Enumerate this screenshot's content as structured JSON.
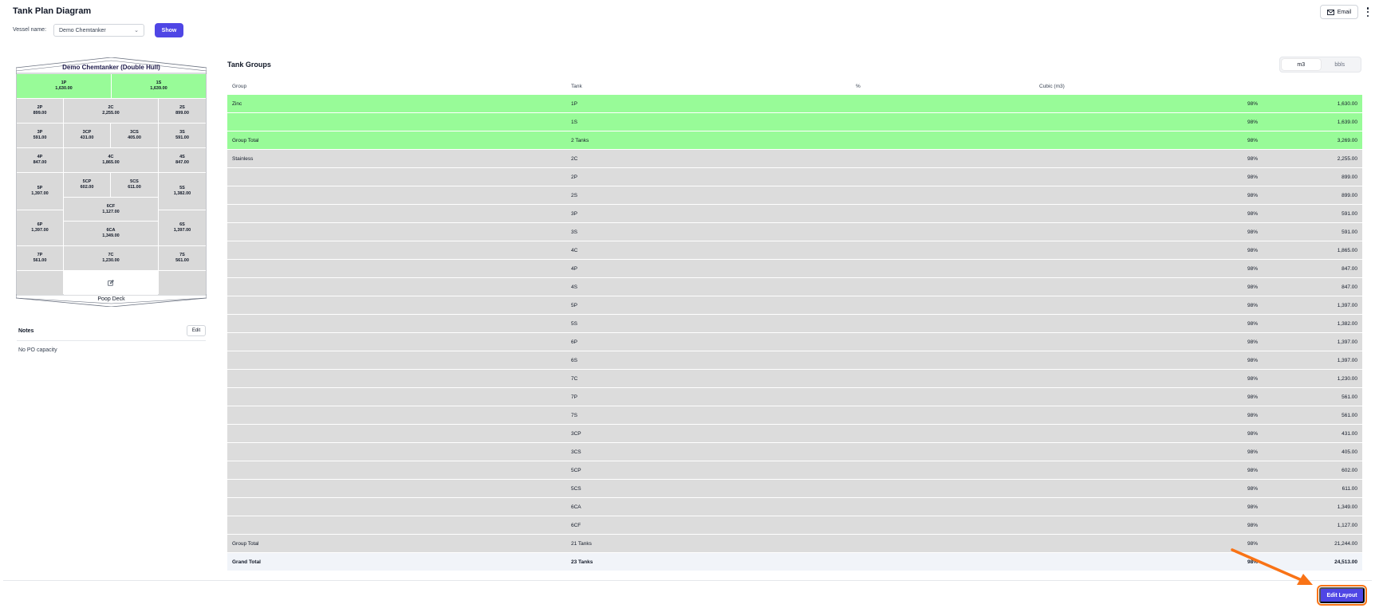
{
  "header": {
    "title": "Tank Plan Diagram",
    "email_label": "Email"
  },
  "vessel": {
    "label": "Vessel name:",
    "selected": "Demo Chemtanker",
    "show_label": "Show"
  },
  "diagram": {
    "ship_name": "Demo Chemtanker (Double Hull)",
    "poop_deck": "Poop Deck",
    "tanks": {
      "t1p": {
        "name": "1P",
        "value": "1,630.00"
      },
      "t1s": {
        "name": "1S",
        "value": "1,639.00"
      },
      "t2p": {
        "name": "2P",
        "value": "899.00"
      },
      "t2c": {
        "name": "2C",
        "value": "2,255.00"
      },
      "t2s": {
        "name": "2S",
        "value": "899.00"
      },
      "t3p": {
        "name": "3P",
        "value": "591.00"
      },
      "t3cp": {
        "name": "3CP",
        "value": "431.00"
      },
      "t3cs": {
        "name": "3CS",
        "value": "405.00"
      },
      "t3s": {
        "name": "3S",
        "value": "591.00"
      },
      "t4p": {
        "name": "4P",
        "value": "847.00"
      },
      "t4c": {
        "name": "4C",
        "value": "1,865.00"
      },
      "t4s": {
        "name": "4S",
        "value": "847.00"
      },
      "t5p": {
        "name": "5P",
        "value": "1,397.00"
      },
      "t5cp": {
        "name": "5CP",
        "value": "602.00"
      },
      "t5cs": {
        "name": "5CS",
        "value": "611.00"
      },
      "t5s": {
        "name": "5S",
        "value": "1,382.00"
      },
      "t6cf": {
        "name": "6CF",
        "value": "1,127.00"
      },
      "t6p": {
        "name": "6P",
        "value": "1,397.00"
      },
      "t6ca": {
        "name": "6CA",
        "value": "1,349.00"
      },
      "t6s": {
        "name": "6S",
        "value": "1,397.00"
      },
      "t7p": {
        "name": "7P",
        "value": "561.00"
      },
      "t7c": {
        "name": "7C",
        "value": "1,230.00"
      },
      "t7s": {
        "name": "7S",
        "value": "561.00"
      }
    }
  },
  "notes": {
    "title": "Notes",
    "edit_label": "Edit",
    "text": "No PO capacity"
  },
  "tank_groups": {
    "title": "Tank Groups",
    "units": [
      "m3",
      "bbls"
    ],
    "active_unit": "m3",
    "columns": [
      "Group",
      "Tank",
      "%",
      "Cubic (m3)"
    ],
    "rows": [
      {
        "group": "Zinc",
        "tank": "1P",
        "pct": "98%",
        "cubic": "1,630.00",
        "style": "green"
      },
      {
        "group": "",
        "tank": "1S",
        "pct": "98%",
        "cubic": "1,639.00",
        "style": "green"
      },
      {
        "group": "Group Total",
        "tank": "2 Tanks",
        "pct": "98%",
        "cubic": "3,269.00",
        "style": "green"
      },
      {
        "group": "Stainless",
        "tank": "2C",
        "pct": "98%",
        "cubic": "2,255.00",
        "style": "grey"
      },
      {
        "group": "",
        "tank": "2P",
        "pct": "98%",
        "cubic": "899.00",
        "style": "grey"
      },
      {
        "group": "",
        "tank": "2S",
        "pct": "98%",
        "cubic": "899.00",
        "style": "grey"
      },
      {
        "group": "",
        "tank": "3P",
        "pct": "98%",
        "cubic": "591.00",
        "style": "grey"
      },
      {
        "group": "",
        "tank": "3S",
        "pct": "98%",
        "cubic": "591.00",
        "style": "grey"
      },
      {
        "group": "",
        "tank": "4C",
        "pct": "98%",
        "cubic": "1,865.00",
        "style": "grey"
      },
      {
        "group": "",
        "tank": "4P",
        "pct": "98%",
        "cubic": "847.00",
        "style": "grey"
      },
      {
        "group": "",
        "tank": "4S",
        "pct": "98%",
        "cubic": "847.00",
        "style": "grey"
      },
      {
        "group": "",
        "tank": "5P",
        "pct": "98%",
        "cubic": "1,397.00",
        "style": "grey"
      },
      {
        "group": "",
        "tank": "5S",
        "pct": "98%",
        "cubic": "1,382.00",
        "style": "grey"
      },
      {
        "group": "",
        "tank": "6P",
        "pct": "98%",
        "cubic": "1,397.00",
        "style": "grey"
      },
      {
        "group": "",
        "tank": "6S",
        "pct": "98%",
        "cubic": "1,397.00",
        "style": "grey"
      },
      {
        "group": "",
        "tank": "7C",
        "pct": "98%",
        "cubic": "1,230.00",
        "style": "grey"
      },
      {
        "group": "",
        "tank": "7P",
        "pct": "98%",
        "cubic": "561.00",
        "style": "grey"
      },
      {
        "group": "",
        "tank": "7S",
        "pct": "98%",
        "cubic": "561.00",
        "style": "grey"
      },
      {
        "group": "",
        "tank": "3CP",
        "pct": "98%",
        "cubic": "431.00",
        "style": "grey"
      },
      {
        "group": "",
        "tank": "3CS",
        "pct": "98%",
        "cubic": "405.00",
        "style": "grey"
      },
      {
        "group": "",
        "tank": "5CP",
        "pct": "98%",
        "cubic": "602.00",
        "style": "grey"
      },
      {
        "group": "",
        "tank": "5CS",
        "pct": "98%",
        "cubic": "611.00",
        "style": "grey"
      },
      {
        "group": "",
        "tank": "6CA",
        "pct": "98%",
        "cubic": "1,349.00",
        "style": "grey"
      },
      {
        "group": "",
        "tank": "6CF",
        "pct": "98%",
        "cubic": "1,127.00",
        "style": "grey"
      },
      {
        "group": "Group Total",
        "tank": "21 Tanks",
        "pct": "98%",
        "cubic": "21,244.00",
        "style": "grey"
      },
      {
        "group": "Grand Total",
        "tank": "23 Tanks",
        "pct": "98%",
        "cubic": "24,513.00",
        "style": "grand"
      }
    ]
  },
  "footer": {
    "edit_layout_label": "Edit Layout"
  },
  "colors": {
    "accent": "#4f46e5",
    "zinc_group": "#98fb98",
    "stainless_group": "#dcdcdc",
    "highlight": "#f97316"
  },
  "icons": {
    "email": "mail-icon",
    "more": "kebab-icon",
    "select": "chevron-down-icon",
    "edit_tank": "pencil-square-icon"
  }
}
